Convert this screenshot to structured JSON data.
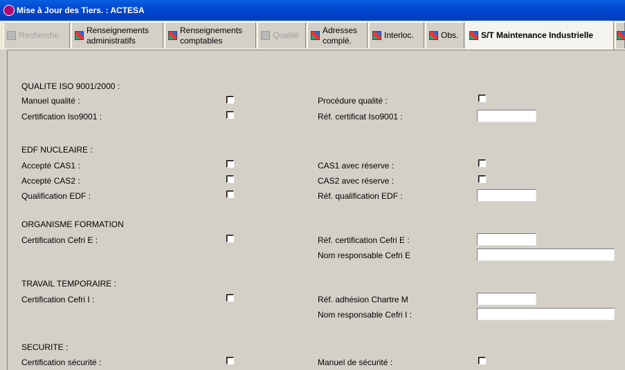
{
  "window": {
    "title": "Mise à Jour des Tiers. : ACTESA"
  },
  "tabs": [
    {
      "line1": "Recherche",
      "line2": ""
    },
    {
      "line1": "Renseignements",
      "line2": "administratifs"
    },
    {
      "line1": "Renseignements",
      "line2": "comptables"
    },
    {
      "line1": "Qualité",
      "line2": ""
    },
    {
      "line1": "Adresses",
      "line2": "complé."
    },
    {
      "line1": "Interloc.",
      "line2": ""
    },
    {
      "line1": "Obs.",
      "line2": ""
    },
    {
      "line1": "S/T Maintenance Industrielle",
      "line2": ""
    }
  ],
  "iso": {
    "heading": "QUALITE ISO 9001/2000 :",
    "manuel": "Manuel qualité :",
    "procedure": "Procédure qualité :",
    "certif": "Certification Iso9001 :",
    "ref_certif": "Réf. certificat Iso9001 :"
  },
  "edf": {
    "heading": "EDF NUCLEAIRE :",
    "cas1": "Accepté CAS1 :",
    "cas1_res": "CAS1 avec réserve :",
    "cas2": "Accepté CAS2 :",
    "cas2_res": "CAS2 avec réserve :",
    "qualif": "Qualification EDF :",
    "ref_qualif": "Réf. qualification EDF :"
  },
  "formation": {
    "heading": "ORGANISME FORMATION",
    "certif": "Certification Cefri  E  :",
    "ref_certif": "Réf. certification Cefri  E  :",
    "nom_resp": "Nom responsable Cefri  E"
  },
  "temporaire": {
    "heading": "TRAVAIL TEMPORAIRE :",
    "certif": "Certification Cefri  I  :",
    "ref_adh": "Réf. adhésion Chartre  M",
    "nom_resp": "Nom responsable Cefri  I  :"
  },
  "securite": {
    "heading": "SECURITE :",
    "certif": "Certification sécurité :",
    "manuel": "Manuel de sécurité :"
  }
}
